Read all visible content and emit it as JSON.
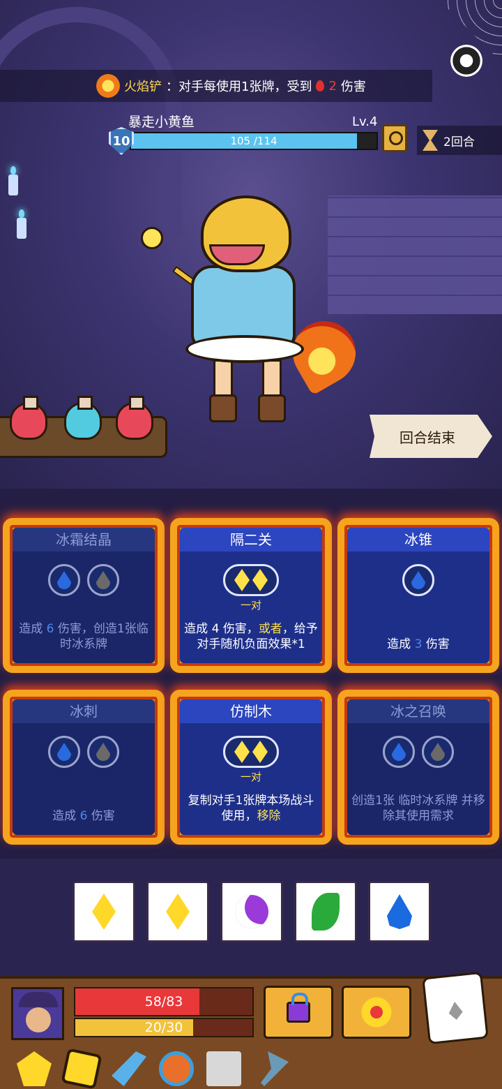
{
  "banner": {
    "name": "火焰铲",
    "text": "：对手每使用1张牌，受到",
    "damage": "2",
    "suffix": "伤害",
    "icon": "fire-shovel-icon"
  },
  "enemy": {
    "name": "暴走小黄鱼",
    "level": "Lv.4",
    "shield": "10",
    "hp_text": "105 /114",
    "hp_fraction": 0.921
  },
  "turn": {
    "label": "2回合"
  },
  "end_turn": {
    "label": "回合结束"
  },
  "potions": [
    {
      "color": "#e8495a",
      "icon": "red-potion-icon"
    },
    {
      "color": "#52cbe0",
      "icon": "blue-potion-icon"
    },
    {
      "color": "#e8495a",
      "icon": "red-potion-icon"
    }
  ],
  "cards": [
    {
      "title": "冰霜结晶",
      "usable": false,
      "slots": [
        "water",
        "gray-water"
      ],
      "pair": "",
      "desc_a": "造成",
      "desc_num": "6",
      "desc_b": "伤害，创造1张临时",
      "desc_c": "冰系牌"
    },
    {
      "title": "隔二关",
      "usable": true,
      "slots": [
        "diamond-pair"
      ],
      "pair": "一对",
      "desc_a": "造成",
      "desc_num": "4",
      "desc_b": "伤害，",
      "desc_hl": "或者",
      "desc_c": "，给予对手随机负面效果*1"
    },
    {
      "title": "冰锥",
      "usable": true,
      "slots": [
        "water"
      ],
      "pair": "",
      "desc_a": "造成",
      "desc_num": "3",
      "desc_b": "伤害"
    },
    {
      "title": "冰刺",
      "usable": false,
      "slots": [
        "water",
        "gray-water"
      ],
      "pair": "",
      "desc_a": "造成",
      "desc_num": "6",
      "desc_b": "伤害"
    },
    {
      "title": "仿制木",
      "usable": true,
      "slots": [
        "diamond-pair"
      ],
      "pair": "一对",
      "desc_a": "复制对手1张牌本场战斗使用，",
      "desc_hl": "移除"
    },
    {
      "title": "冰之召唤",
      "usable": false,
      "slots": [
        "water",
        "gray-water"
      ],
      "pair": "",
      "desc_a": "创造1张 临时",
      "desc_b": "冰系牌 并移除其使用需求"
    }
  ],
  "dice": [
    {
      "face": "yellow-diamond-icon"
    },
    {
      "face": "yellow-diamond-icon"
    },
    {
      "face": "purple-moon-icon"
    },
    {
      "face": "green-leaf-icon"
    },
    {
      "face": "blue-drop-icon"
    }
  ],
  "player": {
    "hp_text": "58/83",
    "hp_fraction": 0.699,
    "energy_text": "20/30",
    "energy_fraction": 0.667
  },
  "nav_icons": [
    "armor-icon",
    "relic-icon",
    "sword-icon",
    "skill-orb-icon",
    "scroll-icon",
    "axe-icon"
  ]
}
